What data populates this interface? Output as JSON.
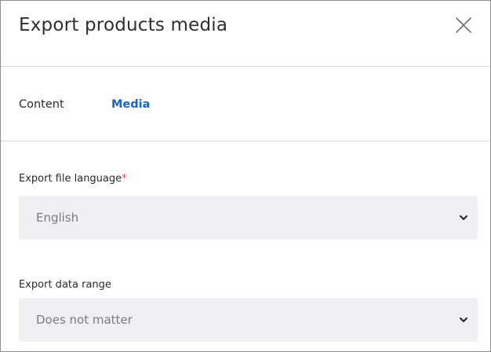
{
  "dialog": {
    "title": "Export products media"
  },
  "tabs": [
    {
      "label": "Content",
      "active": false
    },
    {
      "label": "Media",
      "active": true
    }
  ],
  "fields": {
    "language": {
      "label": "Export file language",
      "required_marker": "*",
      "value": "English"
    },
    "range": {
      "label": "Export data range",
      "value": "Does not matter"
    }
  },
  "icons": {
    "close": "close-icon",
    "dropdown": "chevron-down-icon"
  },
  "colors": {
    "accent": "#1565d0",
    "required": "#e8455d",
    "select_background": "#eef0f4",
    "divider": "#dcdcdc"
  }
}
